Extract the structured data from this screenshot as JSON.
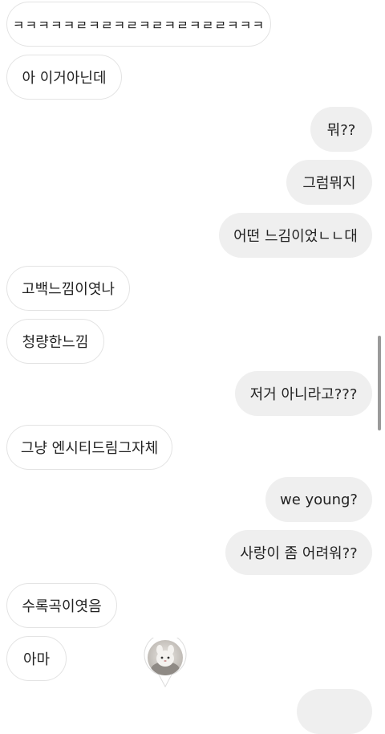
{
  "messages": [
    {
      "side": "received",
      "text": "ㅋㅋㅋㅋㅋㄹㅋㄹㅋㄹㅋㄹㅋㄹㅋㄹㄹㅋㅋㅋ"
    },
    {
      "side": "received",
      "text": "아 이거아닌데"
    },
    {
      "side": "sent",
      "text": "뭐??"
    },
    {
      "side": "sent",
      "text": "그럼뭐지"
    },
    {
      "side": "sent",
      "text": "어떤 느김이었ㄴㄴ대"
    },
    {
      "side": "received",
      "text": "고백느낌이엿나"
    },
    {
      "side": "received",
      "text": "청량한느낌"
    },
    {
      "side": "sent",
      "text": "저거 아니라고???"
    },
    {
      "side": "received",
      "text": "그냥 엔시티드림그자체"
    },
    {
      "side": "sent",
      "text": "we young?"
    },
    {
      "side": "sent",
      "text": "사랑이 좀 어려워??"
    },
    {
      "side": "received",
      "text": "수록곡이엿음"
    },
    {
      "side": "received",
      "text": "아마"
    }
  ],
  "colors": {
    "sent_bubble": "#efefef",
    "received_border": "#e3e3e3",
    "text": "#222222"
  },
  "icons": {
    "avatar": "profile-avatar-icon"
  }
}
